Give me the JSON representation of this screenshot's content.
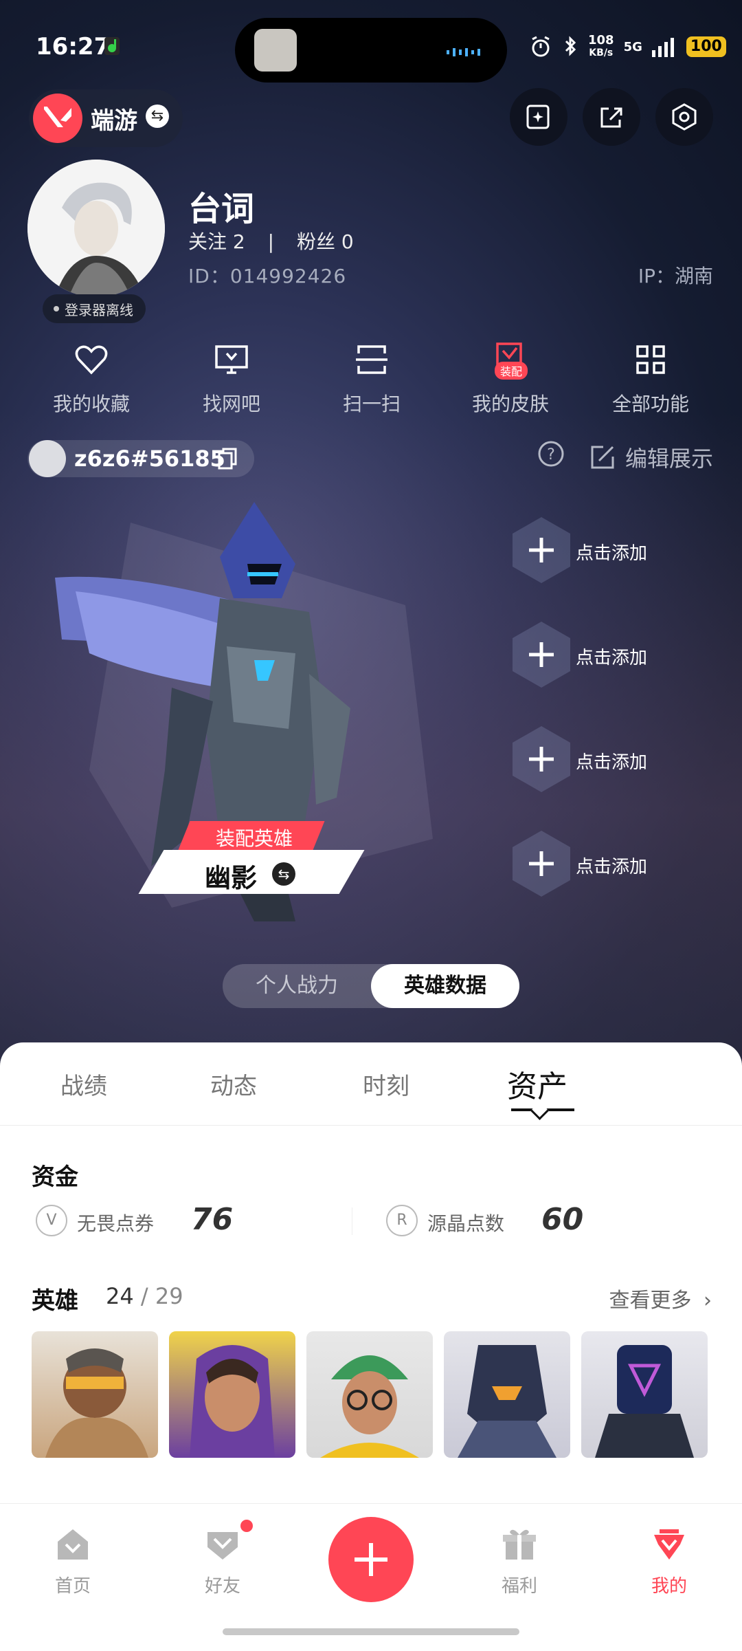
{
  "status_bar": {
    "time": "16:27",
    "net_speed_top": "108",
    "net_speed_unit": "KB/s",
    "network": "5G",
    "battery": "100"
  },
  "header": {
    "brand_label": "端游",
    "brand_switch_icon": "⇆"
  },
  "profile": {
    "name": "台词",
    "follow": "关注 2",
    "fans": "粉丝 0",
    "separator": "|",
    "id_text": "ID：014992426",
    "ip_text": "IP：湖南",
    "login_status": "登录器离线"
  },
  "quick_actions": [
    {
      "label": "我的收藏",
      "icon": "heart-icon"
    },
    {
      "label": "找网吧",
      "icon": "monitor-icon"
    },
    {
      "label": "扫一扫",
      "icon": "scan-icon"
    },
    {
      "label": "我的皮肤",
      "icon": "skin-icon",
      "badge": "装配"
    },
    {
      "label": "全部功能",
      "icon": "grid-icon"
    }
  ],
  "player_tag": {
    "text": "z6z6#56185"
  },
  "edit_display": {
    "label": "编辑展示"
  },
  "equipped_hero": {
    "tag": "装配英雄",
    "name": "幽影"
  },
  "add_slots": [
    {
      "label": "点击添加"
    },
    {
      "label": "点击添加"
    },
    {
      "label": "点击添加"
    },
    {
      "label": "点击添加"
    }
  ],
  "segments": {
    "left": "个人战力",
    "right": "英雄数据"
  },
  "tabs": [
    {
      "label": "战绩"
    },
    {
      "label": "动态"
    },
    {
      "label": "时刻"
    },
    {
      "label": "资产"
    }
  ],
  "funds": {
    "title": "资金",
    "items": [
      {
        "label": "无畏点券",
        "value": "76",
        "icon": "valorant-point-icon"
      },
      {
        "label": "源晶点数",
        "value": "60",
        "icon": "radianite-icon"
      }
    ]
  },
  "heroes": {
    "title": "英雄",
    "owned": "24",
    "total": "/ 29",
    "more": "查看更多",
    "cards": [
      "hero-1",
      "hero-2",
      "hero-3",
      "hero-4",
      "hero-5"
    ]
  },
  "bottom_nav": [
    {
      "label": "首页"
    },
    {
      "label": "好友"
    },
    {
      "label": "福利"
    },
    {
      "label": "我的"
    }
  ],
  "colors": {
    "accent": "#ff4655",
    "sheet": "#ffffff",
    "bg": "#151c31"
  }
}
